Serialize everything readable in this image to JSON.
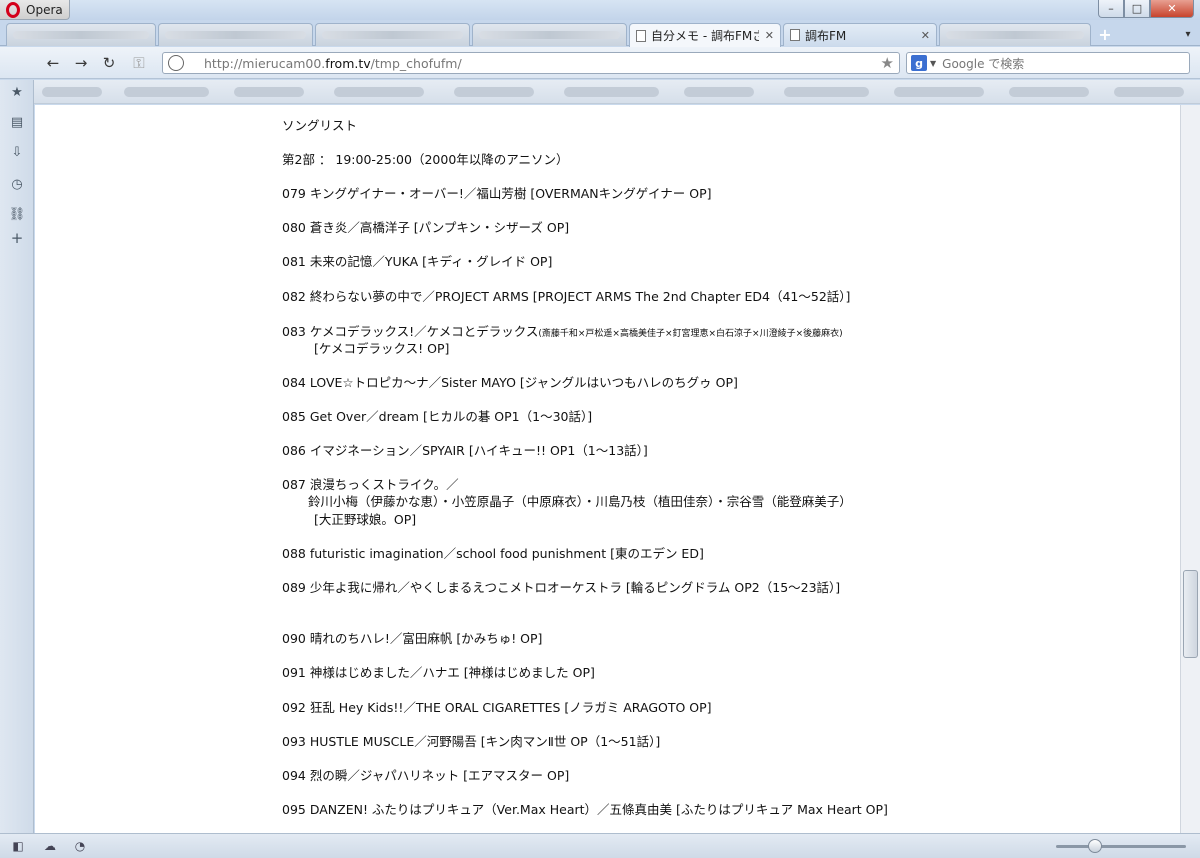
{
  "window": {
    "app_label": "Opera",
    "min_glyph": "–",
    "max_glyph": "□",
    "close_glyph": "✕"
  },
  "tabs": {
    "active": {
      "title": "自分メモ - 調布FMさ…",
      "close": "✕"
    },
    "second": {
      "title": "調布FM",
      "close": "✕"
    },
    "new_tab": "+",
    "tab_list": "▾"
  },
  "nav": {
    "back": "←",
    "forward": "→",
    "reload": "↻",
    "key": "⚿",
    "url_prefix": "http://mierucam00.",
    "url_domain": "from.tv",
    "url_path": "/tmp_chofufm/",
    "bookmark_star": "★",
    "search_engine_badge": "g",
    "search_dropdown": "▼",
    "search_placeholder": "Google で検索"
  },
  "side_panel": {
    "bookmarks_icon": "★",
    "notes_icon": "▤",
    "downloads_icon": "⇩",
    "history_icon": "◷",
    "links_icon": "⛓",
    "add_icon": "+"
  },
  "content": {
    "heading": "ソングリスト",
    "section": "第2部 ： 19:00-25:00（2000年以降のアニソン）",
    "songs": {
      "s079": "079 キングゲイナー・オーバー!／福山芳樹 [OVERMANキングゲイナー OP]",
      "s080": "080 蒼き炎／高橋洋子 [パンプキン・シザーズ OP]",
      "s081": "081 未来の記憶／YUKA [キディ・グレイド OP]",
      "s082": "082 終わらない夢の中で／PROJECT ARMS [PROJECT ARMS The 2nd Chapter ED4（41～52話）]",
      "s083_main": "083 ケメコデラックス!／ケメコとデラックス",
      "s083_small": "(斎藤千和×戸松遥×高橋美佳子×釘宮理恵×白石涼子×川澄綾子×後藤麻衣)",
      "s083_sub": "[ケメコデラックス! OP]",
      "s084": "084 LOVE☆トロピカ～ナ／Sister MAYO [ジャングルはいつもハレのちグゥ OP]",
      "s085": "085 Get Over／dream [ヒカルの碁 OP1（1～30話）]",
      "s086": "086 イマジネーション／SPYAIR [ハイキュー!! OP1（1～13話）]",
      "s087_main": "087 浪漫ちっくストライク。／",
      "s087_artists": "鈴川小梅（伊藤かな恵）・小笠原晶子（中原麻衣）・川島乃枝（植田佳奈）・宗谷雪（能登麻美子）",
      "s087_sub": "[大正野球娘。OP]",
      "s088": "088 futuristic imagination／school food punishment [東のエデン ED]",
      "s089": "089 少年よ我に帰れ／やくしまるえつこメトロオーケストラ [輪るピングドラム OP2（15～23話）]",
      "s090": "090 晴れのちハレ!／富田麻帆 [かみちゅ! OP]",
      "s091": "091 神様はじめました／ハナエ [神様はじめました OP]",
      "s092": "092 狂乱 Hey Kids!!／THE ORAL CIGARETTES [ノラガミ ARAGOTO OP]",
      "s093": "093 HUSTLE MUSCLE／河野陽吾 [キン肉マンⅡ世 OP（1～51話）]",
      "s094": "094 烈の瞬／ジャパハリネット [エアマスター OP]",
      "s095": "095 DANZEN! ふたりはプリキュア（Ver.Max Heart）／五條真由美 [ふたりはプリキュア Max Heart OP]"
    }
  },
  "status": {
    "panel_toggle": "◧",
    "cloud_icon": "☁",
    "speed_icon": "◔"
  }
}
